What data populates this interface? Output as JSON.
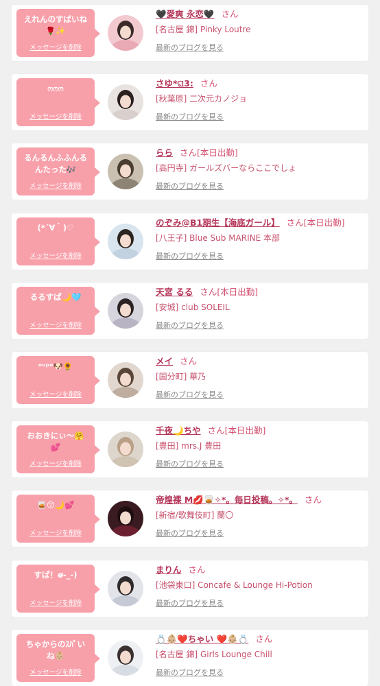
{
  "colors": {
    "background": "#f0f0f1",
    "card": "#ffffff",
    "bubble": "#f8a0aa",
    "name": "#b5365a",
    "text_pink": "#c8506c",
    "link_gray": "#8a8a8a"
  },
  "labels": {
    "delete": "メッセージを削除",
    "blog": "最新のブログを見る",
    "san": "さん"
  },
  "entries": [
    {
      "message": "えれんのすばいね\n🌹✨",
      "name": "🖤愛爽 永恋🖤",
      "status": "",
      "shop": "[名古屋 錦] Pinky Loutre",
      "avatar_icon": "avatar-photo"
    },
    {
      "message": "ෆෆෆ",
      "name": "さゆ*ଘ3:",
      "status": "",
      "shop": "[秋葉原] 二次元カノジョ",
      "avatar_icon": "avatar-photo"
    },
    {
      "message": "るんるんふふんる\nんたった🎶",
      "name": "らら",
      "status": "[本日出勤]",
      "shop": "[高円寺] ガールズバーならここでしょ",
      "avatar_icon": "avatar-photo"
    },
    {
      "message": "(*´∀｀)♡",
      "name": "のぞみ@B1期生【海底ガール】",
      "status": "[本日出勤]",
      "shop": "[八王子] Blue Sub MARINE 本部",
      "avatar_icon": "avatar-photo"
    },
    {
      "message": "るるすぱ🌙🩵",
      "name": "天宮 るる",
      "status": "[本日出勤]",
      "shop": "[安城] club SOLEIL",
      "avatar_icon": "avatar-photo"
    },
    {
      "message": "ᵒᵘᵖᵉ🐶🌻",
      "name": "メイ",
      "status": "",
      "shop": "[国分町] 華乃",
      "avatar_icon": "avatar-photo"
    },
    {
      "message": "おおきにぃ〜🤗\n💕",
      "name": "千夜🌙ちや",
      "status": "[本日出勤]",
      "shop": "[豊田] mrs.J 豊田",
      "avatar_icon": "avatar-photo"
    },
    {
      "message": "🥃😚🌙💕",
      "name": "帝煌裸 M💋🥃✧*。毎日投稿。✧*。",
      "status": "",
      "shop": "[新宿/歌舞伎町] 蘭〇",
      "avatar_icon": "avatar-photo"
    },
    {
      "message": "すぱ！ơ̴-_-)",
      "name": "まりん",
      "status": "",
      "shop": "[池袋東口] Concafe & Lounge Hi-Potion",
      "avatar_icon": "avatar-photo"
    },
    {
      "message": "ちゃからのｽﾊﾟい\nね👶🏼",
      "name": "💍👶🏼❤️ちゃい ❤️👶🏼💍",
      "status": "",
      "shop": "[名古屋 錦] Girls Lounge Chill",
      "avatar_icon": "avatar-photo"
    }
  ]
}
